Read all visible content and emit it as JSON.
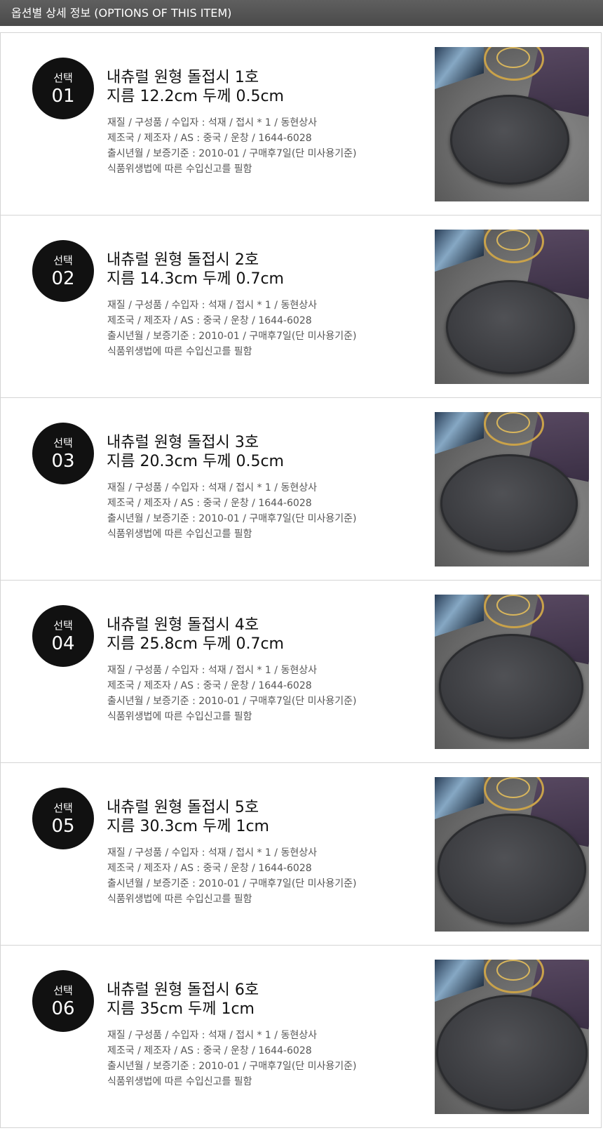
{
  "header": {
    "title": "옵션별 상세 정보 (OPTIONS OF THIS ITEM)"
  },
  "items": [
    {
      "badge_label": "선택",
      "badge_num": "01",
      "title_line1": "내츄럴 원형 돌접시 1호",
      "title_line2": "지름 12.2cm 두께 0.5cm",
      "info1": "재질 / 구성품 / 수입자 : 석재 / 접시 * 1 / 동현상사",
      "info2": "제조국 / 제조자 / AS : 중국 / 운창 / 1644-6028",
      "info3": "출시년월 / 보증기준 : 2010-01 / 구매후7일(단 미사용기준)",
      "info4": "식품위생법에 따른 수입신고를 필함",
      "image": "round-slate-plate-photo"
    },
    {
      "badge_label": "선택",
      "badge_num": "02",
      "title_line1": "내츄럴 원형 돌접시 2호",
      "title_line2": "지름 14.3cm 두께 0.7cm",
      "info1": "재질 / 구성품 / 수입자 : 석재 / 접시 * 1 / 동현상사",
      "info2": "제조국 / 제조자 / AS : 중국 / 운창 / 1644-6028",
      "info3": "출시년월 / 보증기준 : 2010-01 / 구매후7일(단 미사용기준)",
      "info4": "식품위생법에 따른 수입신고를 필함",
      "image": "round-slate-plate-photo"
    },
    {
      "badge_label": "선택",
      "badge_num": "03",
      "title_line1": "내츄럴 원형 돌접시 3호",
      "title_line2": "지름 20.3cm 두께 0.5cm",
      "info1": "재질 / 구성품 / 수입자 : 석재 / 접시 * 1 / 동현상사",
      "info2": "제조국 / 제조자 / AS : 중국 / 운창 / 1644-6028",
      "info3": "출시년월 / 보증기준 : 2010-01 / 구매후7일(단 미사용기준)",
      "info4": "식품위생법에 따른 수입신고를 필함",
      "image": "round-slate-plate-photo"
    },
    {
      "badge_label": "선택",
      "badge_num": "04",
      "title_line1": "내츄럴 원형 돌접시 4호",
      "title_line2": "지름 25.8cm 두께 0.7cm",
      "info1": "재질 / 구성품 / 수입자 : 석재 / 접시 * 1 / 동현상사",
      "info2": "제조국 / 제조자 / AS : 중국 / 운창 / 1644-6028",
      "info3": "출시년월 / 보증기준 : 2010-01 / 구매후7일(단 미사용기준)",
      "info4": "식품위생법에 따른 수입신고를 필함",
      "image": "round-slate-plate-photo"
    },
    {
      "badge_label": "선택",
      "badge_num": "05",
      "title_line1": "내츄럴 원형 돌접시 5호",
      "title_line2": "지름 30.3cm 두께 1cm",
      "info1": "재질 / 구성품 / 수입자 : 석재 / 접시 * 1 / 동현상사",
      "info2": "제조국 / 제조자 / AS : 중국 / 운창 / 1644-6028",
      "info3": "출시년월 / 보증기준 : 2010-01 / 구매후7일(단 미사용기준)",
      "info4": "식품위생법에 따른 수입신고를 필함",
      "image": "round-slate-plate-photo"
    },
    {
      "badge_label": "선택",
      "badge_num": "06",
      "title_line1": "내츄럴 원형 돌접시 6호",
      "title_line2": "지름 35cm 두께 1cm",
      "info1": "재질 / 구성품 / 수입자 : 석재 / 접시 * 1 / 동현상사",
      "info2": "제조국 / 제조자 / AS : 중국 / 운창 / 1644-6028",
      "info3": "출시년월 / 보증기준 : 2010-01 / 구매후7일(단 미사용기준)",
      "info4": "식품위생법에 따른 수입신고를 필함",
      "image": "round-slate-plate-photo"
    }
  ]
}
